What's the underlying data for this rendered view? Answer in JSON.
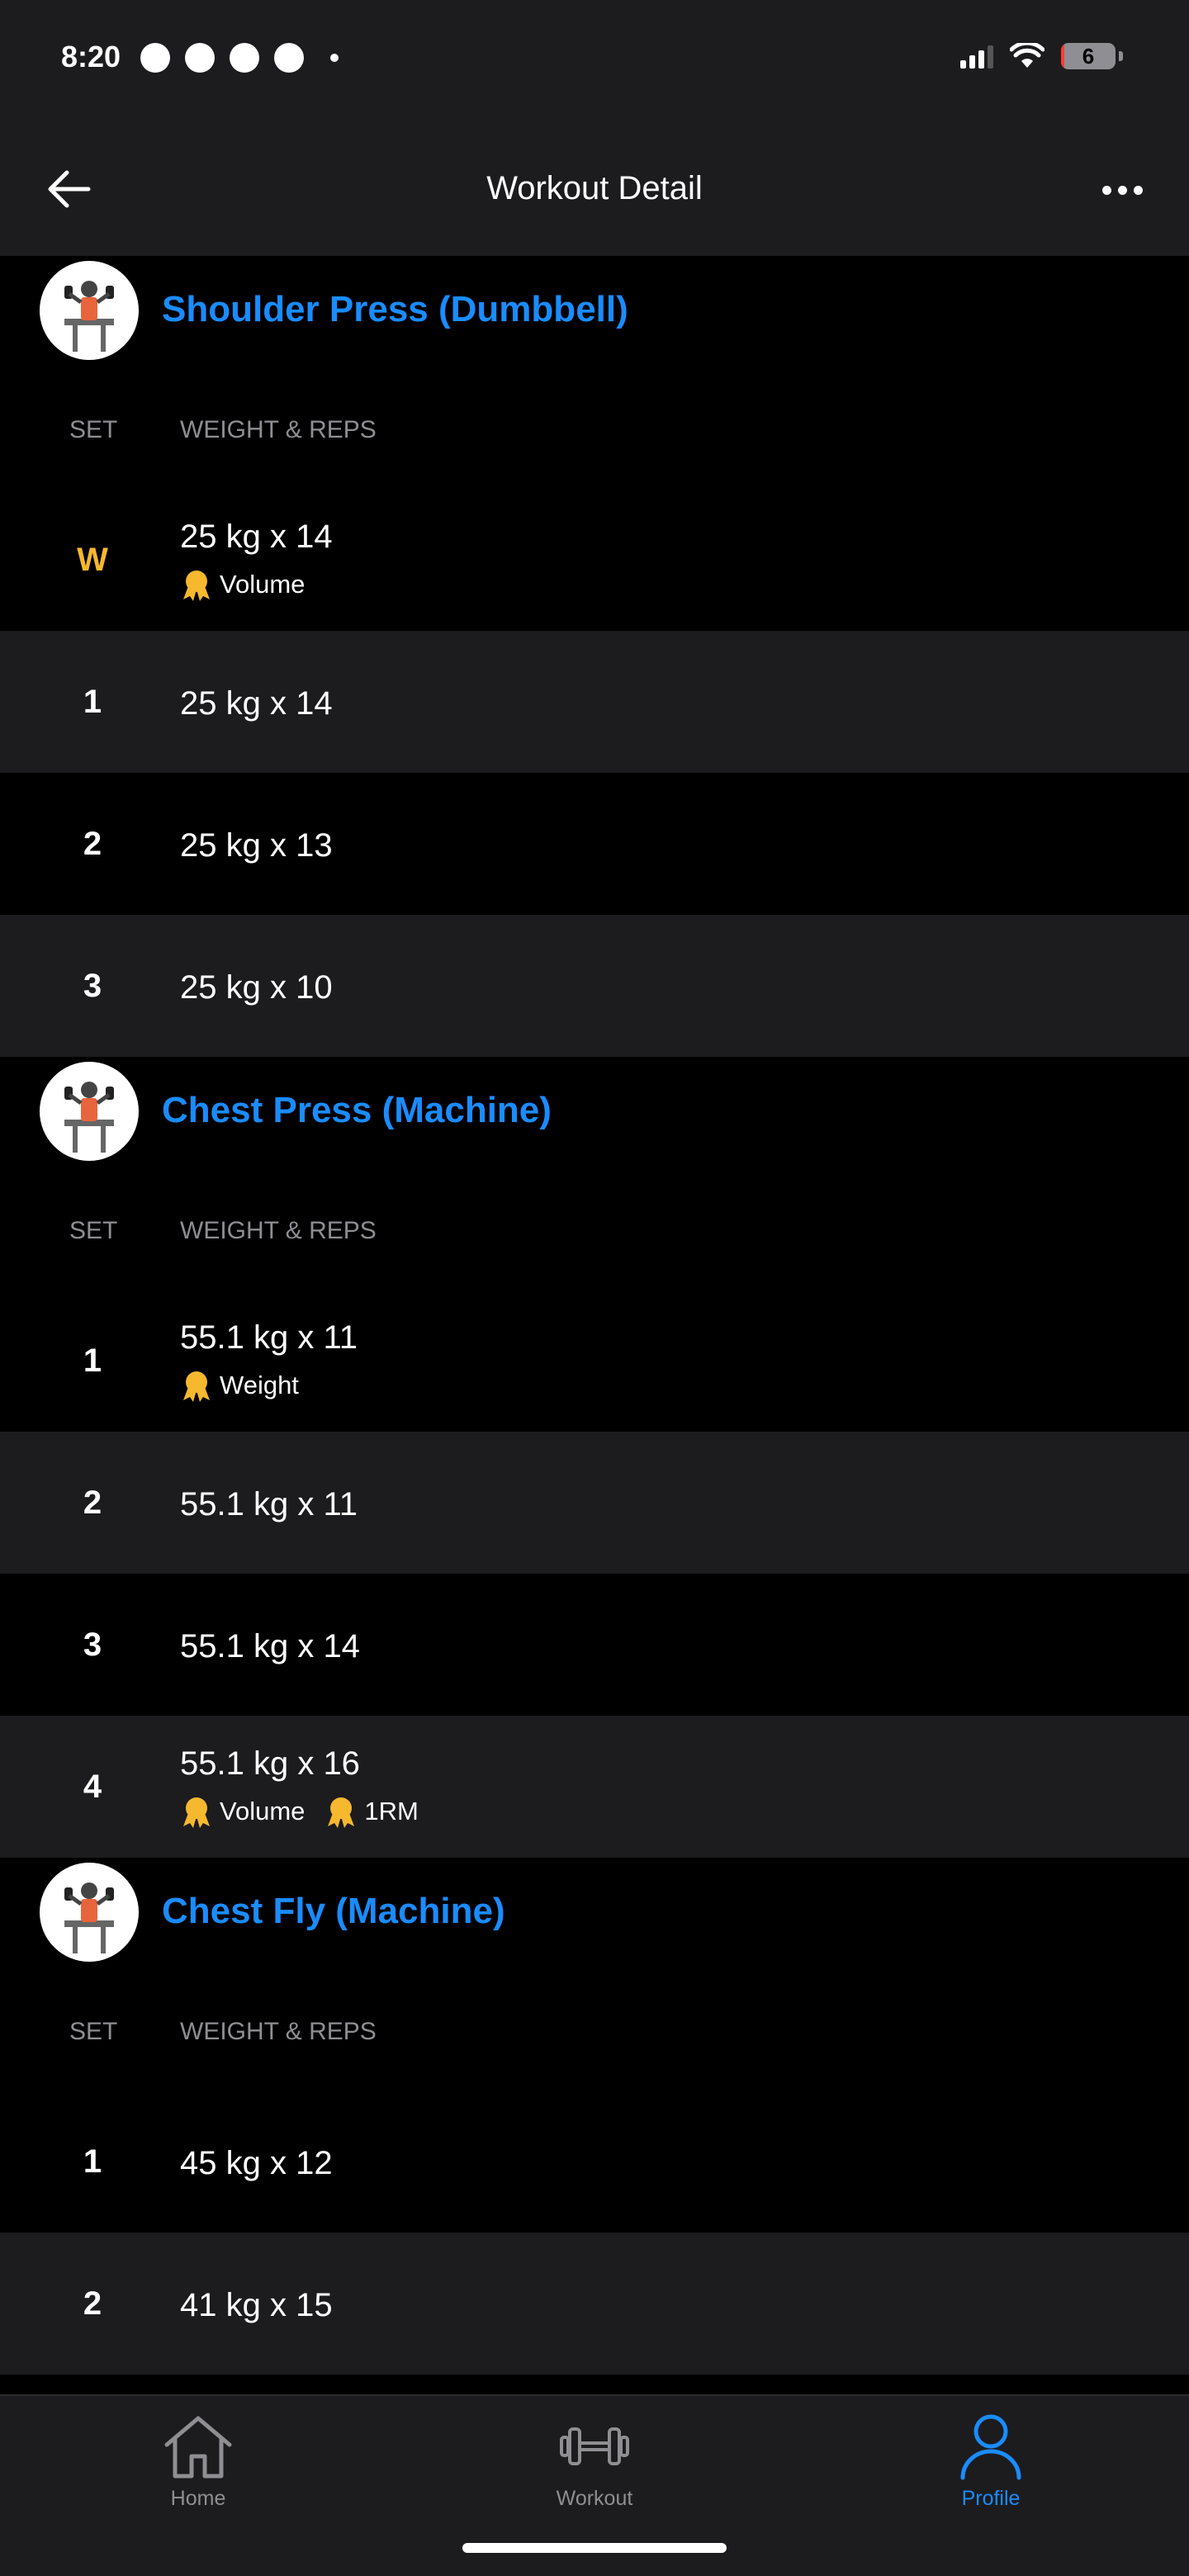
{
  "status_bar": {
    "time": "8:20",
    "battery": "6",
    "battery_level_percent": 6
  },
  "nav": {
    "title": "Workout Detail"
  },
  "exercises": [
    {
      "name": "Shoulder Press (Dumbbell)",
      "col_set": "SET",
      "col_weight_reps": "WEIGHT & REPS",
      "sets": [
        {
          "set": "W",
          "value": "25 kg x 14",
          "prs": [
            "Volume"
          ]
        },
        {
          "set": "1",
          "value": "25 kg x 14",
          "prs": []
        },
        {
          "set": "2",
          "value": "25 kg x 13",
          "prs": []
        },
        {
          "set": "3",
          "value": "25 kg x 10",
          "prs": []
        }
      ]
    },
    {
      "name": "Chest Press (Machine)",
      "col_set": "SET",
      "col_weight_reps": "WEIGHT & REPS",
      "sets": [
        {
          "set": "1",
          "value": "55.1 kg x 11",
          "prs": [
            "Weight"
          ]
        },
        {
          "set": "2",
          "value": "55.1 kg x 11",
          "prs": []
        },
        {
          "set": "3",
          "value": "55.1 kg x 14",
          "prs": []
        },
        {
          "set": "4",
          "value": "55.1 kg x 16",
          "prs": [
            "Volume",
            "1RM"
          ]
        }
      ]
    },
    {
      "name": "Chest Fly (Machine)",
      "col_set": "SET",
      "col_weight_reps": "WEIGHT & REPS",
      "sets": [
        {
          "set": "1",
          "value": "45 kg x 12",
          "prs": []
        },
        {
          "set": "2",
          "value": "41 kg x 15",
          "prs": []
        }
      ]
    }
  ],
  "tabs": [
    {
      "label": "Home",
      "icon": "home-icon",
      "active": false
    },
    {
      "label": "Workout",
      "icon": "dumbbell-icon",
      "active": false
    },
    {
      "label": "Profile",
      "icon": "person-icon",
      "active": true
    }
  ],
  "colors": {
    "accent": "#1a8cff",
    "warmup": "#f5b82e",
    "medal": "#f5b82e",
    "bg": "#000000",
    "row_alt": "#1c1c1e"
  }
}
